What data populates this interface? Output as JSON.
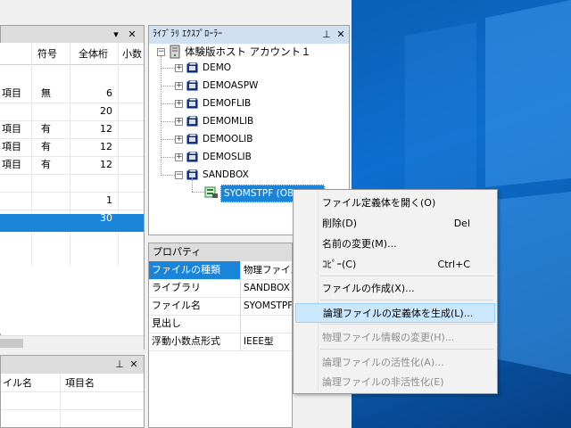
{
  "left_panel": {
    "columns": [
      "符号",
      "全体桁",
      "小数"
    ],
    "rows": [
      {
        "name": "項目",
        "sign": "無",
        "total": "6"
      },
      {
        "name": "",
        "sign": "",
        "total": "20"
      },
      {
        "name": "項目",
        "sign": "有",
        "total": "12"
      },
      {
        "name": "項目",
        "sign": "有",
        "total": "12"
      },
      {
        "name": "項目",
        "sign": "有",
        "total": "12"
      },
      {
        "name": "",
        "sign": "",
        "total": ""
      },
      {
        "name": "",
        "sign": "",
        "total": "1"
      },
      {
        "name": "",
        "sign": "",
        "total": "30"
      }
    ],
    "lower_columns": [
      "イル名",
      "項目名"
    ]
  },
  "explorer": {
    "title": "ﾗｲﾌﾞﾗﾘ ｴｸｽﾌﾟﾛｰﾗｰ",
    "root": "体験版ホスト アカウント１",
    "libraries": [
      "DEMO",
      "DEMOASPW",
      "DEMOFLIB",
      "DEMOMLIB",
      "DEMOOLIB",
      "DEMOSLIB",
      "SANDBOX"
    ],
    "selected_object": "SYOMSTPF (OBJ  FED)"
  },
  "properties": {
    "title": "プロパティ",
    "rows": [
      {
        "key": "ファイルの種類",
        "value": "物理ファイル"
      },
      {
        "key": "ライブラリ",
        "value": "SANDBOX"
      },
      {
        "key": "ファイル名",
        "value": "SYOMSTPF"
      },
      {
        "key": "見出し",
        "value": ""
      },
      {
        "key": "浮動小数点形式",
        "value": "IEEE型"
      }
    ]
  },
  "context_menu": {
    "items": [
      {
        "label": "ファイル定義体を開く(O)",
        "shortcut": "",
        "disabled": false
      },
      {
        "label": "削除(D)",
        "shortcut": "Del",
        "disabled": false
      },
      {
        "label": "名前の変更(M)...",
        "shortcut": "",
        "disabled": false
      },
      {
        "label": "ｺﾋﾟｰ(C)",
        "shortcut": "Ctrl+C",
        "disabled": false
      },
      {
        "label": "ファイルの作成(X)...",
        "shortcut": "",
        "disabled": false
      },
      {
        "label": "論理ファイルの定義体を生成(L)...",
        "shortcut": "",
        "disabled": false
      },
      {
        "label": "物理ファイル情報の変更(H)...",
        "shortcut": "",
        "disabled": true
      },
      {
        "label": "論理ファイルの活性化(A)...",
        "shortcut": "",
        "disabled": true
      },
      {
        "label": "論理ファイルの非活性化(E)",
        "shortcut": "",
        "disabled": true
      }
    ]
  },
  "colors": {
    "selection": "#1a84d8",
    "menu_highlight": "#cce8ff",
    "desktop": "#0d6fd0"
  },
  "icons": [
    "pin-icon",
    "close-icon",
    "chevron-down-icon",
    "server-icon",
    "library-icon",
    "file-object-icon"
  ]
}
